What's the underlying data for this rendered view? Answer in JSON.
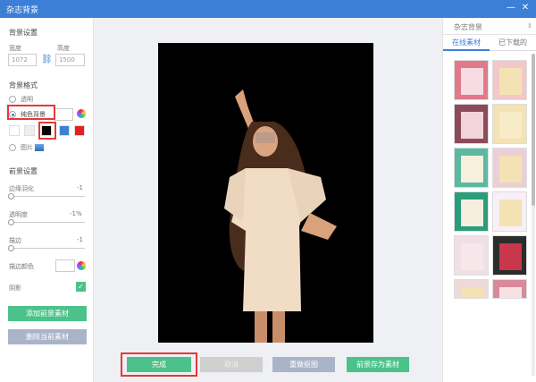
{
  "window": {
    "title": "杂志背景"
  },
  "left": {
    "bg_settings": "背景设置",
    "width_label": "宽度",
    "height_label": "高度",
    "width_value": "1072",
    "height_value": "1500",
    "bg_style": "背景格式",
    "opt_transparent": "透明",
    "opt_solid": "纯色背景",
    "opt_image": "图片",
    "fg_settings": "前景设置",
    "edge_feather": "边缘羽化",
    "edge_feather_value": "-1",
    "opacity": "透明度",
    "opacity_value": "-1%",
    "stroke": "描边",
    "stroke_value": "-1",
    "stroke_color": "描边颜色",
    "shadow": "阴影",
    "add_fg_button": "添加前景素材",
    "delete_fg_button": "删除当前素材"
  },
  "swatch_colors": [
    "#ffffff",
    "#eeeeee",
    "#000000",
    "#3d7fd6",
    "#e62020"
  ],
  "bottom": {
    "done": "完成",
    "cancel": "取消",
    "redo_cutout": "重做抠图",
    "save_fg": "前景存为素材"
  },
  "right": {
    "category": "杂志背景",
    "tab_online": "在线素材",
    "tab_downloaded": "已下载的"
  },
  "thumb_colors": [
    "#e07a8a",
    "#f2c7c9",
    "#8b4b5b",
    "#f3e2b4",
    "#eaa3b3",
    "#f7e9d2",
    "#5bb8a1",
    "#eccfd6",
    "#f8f0f6",
    "#2c2c2c",
    "#f0dfe5",
    "#eed9d9"
  ]
}
